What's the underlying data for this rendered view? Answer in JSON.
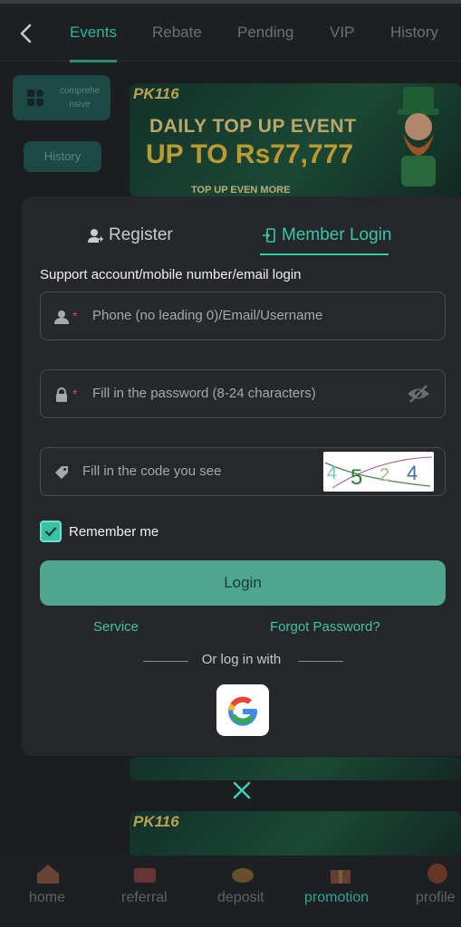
{
  "topnav": {
    "tabs": [
      "Events",
      "Rebate",
      "Pending",
      "VIP",
      "History"
    ],
    "active_tab": "Events"
  },
  "sidebar": {
    "items": [
      {
        "label": "comprehensive",
        "label_display": "comprehe nsive"
      },
      {
        "label": "History"
      }
    ]
  },
  "banners": {
    "logo": "PK116",
    "title1": "DAILY TOP UP EVENT",
    "title2": "UP TO Rs77,777",
    "subtitle": "TOP UP EVEN MORE"
  },
  "modal": {
    "tabs": [
      {
        "label": "Register",
        "icon": "person-plus-icon"
      },
      {
        "label": "Member Login",
        "icon": "login-door-icon"
      }
    ],
    "active_tab": "Member Login",
    "hint": "Support account/mobile number/email login",
    "fields": {
      "account": {
        "placeholder": "Phone (no leading 0)/Email/Username",
        "required": true
      },
      "password": {
        "placeholder": "Fill in the password (8-24 characters)",
        "required": true
      },
      "code": {
        "placeholder": "Fill in the code you see",
        "captcha": "4524"
      }
    },
    "remember_label": "Remember me",
    "remember_checked": true,
    "login_label": "Login",
    "service_label": "Service",
    "forgot_label": "Forgot Password?",
    "or_label": "Or log in with",
    "social": [
      "google-icon"
    ]
  },
  "bottomnav": {
    "items": [
      "home",
      "referral",
      "deposit",
      "promotion",
      "profile"
    ],
    "active": "promotion"
  },
  "colors": {
    "accent": "#38c7aa",
    "background": "#1c1d20",
    "modal_bg": "#25272b",
    "login_button": "#4ea68f"
  }
}
